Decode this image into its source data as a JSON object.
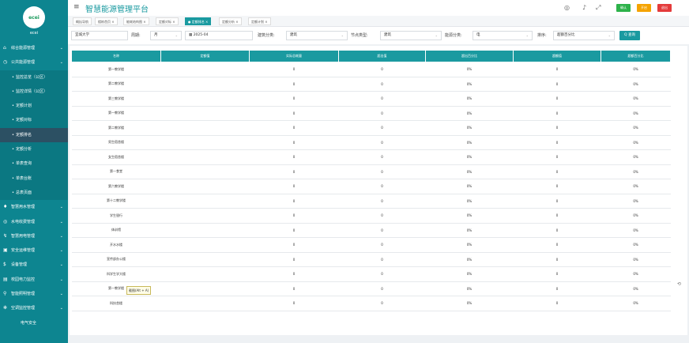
{
  "app": {
    "title": "智慧能源管理平台",
    "user": "ecei",
    "logo_text": "ecei"
  },
  "sidebar": {
    "items": [
      {
        "label": "综合能源管理",
        "type": "top",
        "icon": "home-icon"
      },
      {
        "label": "公共能源管理",
        "type": "top",
        "icon": "clock-icon"
      },
      {
        "label": "监控总览（公区）",
        "type": "sub"
      },
      {
        "label": "监控详情（公区）",
        "type": "sub"
      },
      {
        "label": "定额计划",
        "type": "sub"
      },
      {
        "label": "定额对标",
        "type": "sub"
      },
      {
        "label": "定额排名",
        "type": "sub",
        "active": true
      },
      {
        "label": "定额分析",
        "type": "sub"
      },
      {
        "label": "单表查询",
        "type": "sub"
      },
      {
        "label": "单表台账",
        "type": "sub"
      },
      {
        "label": "总表页面",
        "type": "sub"
      },
      {
        "label": "智慧用水管理",
        "type": "top",
        "icon": "water-icon"
      },
      {
        "label": "水电收费管理",
        "type": "top",
        "icon": "coins-icon"
      },
      {
        "label": "智慧用电管理",
        "type": "top",
        "icon": "bolt-icon"
      },
      {
        "label": "安全运维管理",
        "type": "top",
        "icon": "shield-icon"
      },
      {
        "label": "设备管理",
        "type": "top",
        "icon": "dollar-icon"
      },
      {
        "label": "校园电力监控",
        "type": "top",
        "icon": "monitor-icon"
      },
      {
        "label": "智能照明管理",
        "type": "top",
        "icon": "bulb-icon"
      },
      {
        "label": "空调监控管理",
        "type": "top",
        "icon": "snowflake-icon"
      },
      {
        "label": "电气安全",
        "type": "sub2"
      }
    ]
  },
  "header": {
    "buttons": [
      {
        "label": "确认",
        "color": "#2db24a"
      },
      {
        "label": "开启",
        "color": "#f5a300"
      },
      {
        "label": "退出",
        "color": "#e43b3b"
      }
    ]
  },
  "tabs": [
    {
      "label": "概括导航"
    },
    {
      "label": "楼栋首页 ×"
    },
    {
      "label": "能耗结构图 ×"
    },
    {
      "label": "定额对标 ×"
    },
    {
      "label": "● 定额排名 ×",
      "active": true
    },
    {
      "label": "定额分析 ×"
    },
    {
      "label": "定额计划 ×"
    }
  ],
  "filters": {
    "campus": "宜城大学",
    "period_label": "周期:",
    "period_value": "月",
    "date_value": "2025-04",
    "building_category_label": "建筑分类:",
    "building_category_value": "建筑",
    "node_type_label": "节点类型:",
    "node_type_value": "建筑",
    "energy_category_label": "能源分类:",
    "energy_category_value": "电",
    "sort_label": "排序:",
    "sort_value": "超额百分比",
    "query_label": "Q 查询"
  },
  "table": {
    "columns": [
      "名称",
      "定额值",
      "实际总耗量",
      "超出值",
      "超出百分比",
      "超额值",
      "超额百分比"
    ],
    "rows": [
      [
        "第一教学楼",
        "",
        "0",
        "0",
        "0%",
        "0",
        "0%"
      ],
      [
        "第二教学楼",
        "",
        "0",
        "0",
        "0%",
        "0",
        "0%"
      ],
      [
        "第三教学楼",
        "",
        "0",
        "0",
        "0%",
        "0",
        "0%"
      ],
      [
        "第一教学楼",
        "",
        "0",
        "0",
        "0%",
        "0",
        "0%"
      ],
      [
        "第二教学楼",
        "",
        "0",
        "0",
        "0%",
        "0",
        "0%"
      ],
      [
        "男生宿舍楼",
        "",
        "0",
        "0",
        "0%",
        "0",
        "0%"
      ],
      [
        "女生宿舍楼",
        "",
        "0",
        "0",
        "0%",
        "0",
        "0%"
      ],
      [
        "第一食堂",
        "",
        "0",
        "0",
        "0%",
        "0",
        "0%"
      ],
      [
        "第六教学楼",
        "",
        "0",
        "0",
        "0%",
        "0",
        "0%"
      ],
      [
        "第十二教学楼",
        "",
        "0",
        "0",
        "0%",
        "0",
        "0%"
      ],
      [
        "学生银行",
        "",
        "0",
        "0",
        "0%",
        "0",
        "0%"
      ],
      [
        "体训馆",
        "",
        "0",
        "0",
        "0%",
        "0",
        "0%"
      ],
      [
        "开水水楼",
        "",
        "0",
        "0",
        "0%",
        "0",
        "0%"
      ],
      [
        "宣传部办公楼",
        "",
        "0",
        "0",
        "0%",
        "0",
        "0%"
      ],
      [
        "科学生学大楼",
        "",
        "0",
        "0",
        "0%",
        "0",
        "0%"
      ],
      [
        "第一教学楼",
        "",
        "0",
        "0",
        "0%",
        "0",
        "0%"
      ],
      [
        "科技舍楼",
        "",
        "0",
        "0",
        "0%",
        "0",
        "0%"
      ]
    ]
  },
  "tooltip": "截图(Alt + A)"
}
